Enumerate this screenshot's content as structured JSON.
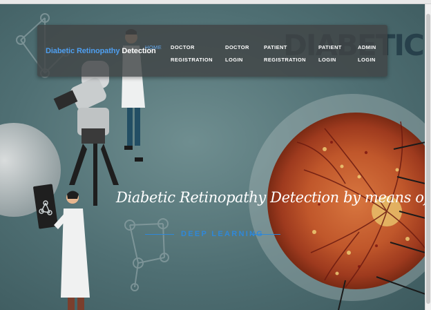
{
  "brand": {
    "part1": "Diabetic Retinopathy",
    "part2": "Detection"
  },
  "nav": [
    {
      "line1": "HOME",
      "line2": ""
    },
    {
      "line1": "DOCTOR",
      "line2": "REGISTRATION"
    },
    {
      "line1": "DOCTOR",
      "line2": "LOGIN"
    },
    {
      "line1": "PATIENT",
      "line2": "REGISTRATION"
    },
    {
      "line1": "PATIENT",
      "line2": "LOGIN"
    },
    {
      "line1": "ADMIN",
      "line2": "LOGIN"
    }
  ],
  "background_text": "DIABETIC RET",
  "hero": {
    "tagline": "Diabetic Retinopathy Detection by means of",
    "subtitle": "DEEP LEARNING"
  },
  "colors": {
    "accent": "#4f9ff0",
    "subtitle": "#2f88d9",
    "nav_bg": "#414446",
    "hero_bg": "#5a787c"
  }
}
